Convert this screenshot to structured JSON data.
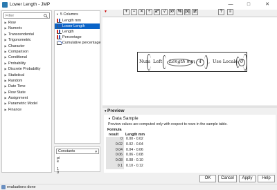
{
  "window": {
    "title": "Lower Length - JMP",
    "minimize": "—",
    "maximize": "□",
    "close": "✕"
  },
  "functions": {
    "filter_placeholder": "Filter",
    "items": [
      "Row",
      "Numeric",
      "Transcendental",
      "Trigonometric",
      "Character",
      "Comparison",
      "Conditional",
      "Probability",
      "Discrete Probability",
      "Statistical",
      "Random",
      "Date Time",
      "Row State",
      "Assignment",
      "Parametric Model",
      "Finance"
    ]
  },
  "columns": {
    "header": "5 Columns",
    "items": [
      {
        "label": "Length mm",
        "icon": "continuous-column-icon",
        "selected": false
      },
      {
        "label": "Lower Length",
        "icon": "formula-column-icon",
        "selected": true
      },
      {
        "label": "Length",
        "icon": "continuous-column-icon",
        "selected": false
      },
      {
        "label": "Percentage",
        "icon": "continuous-column-icon",
        "selected": false
      },
      {
        "label": "Cumulative percentage",
        "icon": "formula-column-icon",
        "selected": false
      }
    ]
  },
  "constants": {
    "selected": "Constants",
    "items": [
      "pi",
      "e",
      "",
      "1",
      "0"
    ]
  },
  "toolbar": {
    "buttons": [
      "+",
      "−",
      "×",
      "÷",
      "a²",
      "√",
      "xʸ",
      "%",
      "|x|",
      "⇄",
      "?",
      "≡"
    ]
  },
  "formula": {
    "func_num": "Num",
    "func_left": "Left",
    "arg_col": "Length mm",
    "arg_n": "4",
    "use_locale": "Use Locale",
    "locale_val": "0"
  },
  "preview": {
    "title": "Preview",
    "data_sample": "Data Sample",
    "note": "Preview values are computed only with respect to rows in the sample table.",
    "col1_header_line1": "Formula",
    "col1_header_line2": "result",
    "col2_header": "Length mm",
    "rows": [
      {
        "result": "0",
        "length": "0.00 - 0.02"
      },
      {
        "result": "0.02",
        "length": "0.02 - 0.04"
      },
      {
        "result": "0.04",
        "length": "0.04 - 0.06"
      },
      {
        "result": "0.06",
        "length": "0.06 - 0.08"
      },
      {
        "result": "0.08",
        "length": "0.08 - 0.10"
      },
      {
        "result": "0.1",
        "length": "0.10 - 0.12"
      }
    ]
  },
  "buttons": {
    "ok": "OK",
    "cancel": "Cancel",
    "apply": "Apply",
    "help": "Help"
  },
  "status": {
    "text": "evaluations done"
  }
}
